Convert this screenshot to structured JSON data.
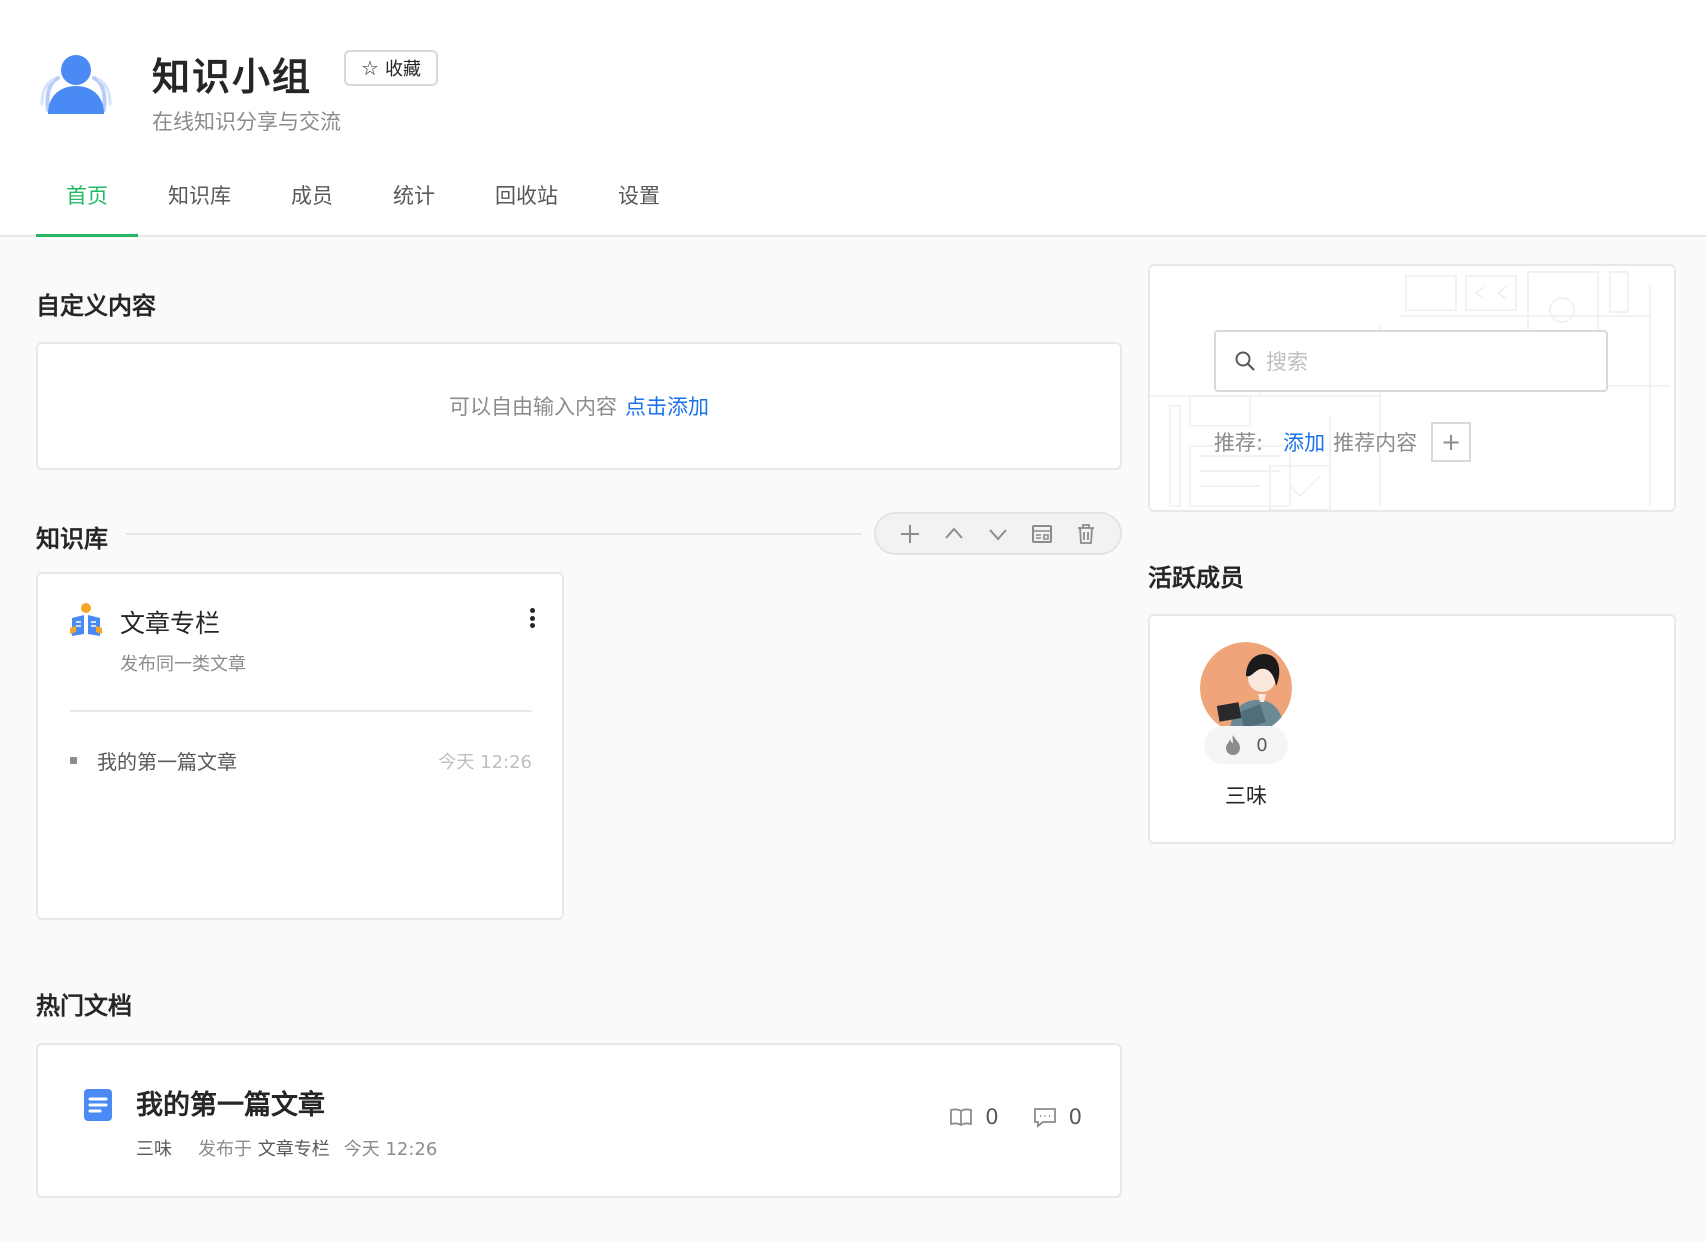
{
  "group": {
    "title": "知识小组",
    "subtitle": "在线知识分享与交流",
    "favorite_label": "收藏"
  },
  "tabs": [
    {
      "label": "首页",
      "active": true
    },
    {
      "label": "知识库",
      "active": false
    },
    {
      "label": "成员",
      "active": false
    },
    {
      "label": "统计",
      "active": false
    },
    {
      "label": "回收站",
      "active": false
    },
    {
      "label": "设置",
      "active": false
    }
  ],
  "custom_content": {
    "title": "自定义内容",
    "hint": "可以自由输入内容",
    "add_link": "点击添加"
  },
  "knowledge_base": {
    "title": "知识库",
    "toolbar_icons": [
      "plus-icon",
      "chevron-up-icon",
      "chevron-down-icon",
      "layout-icon",
      "trash-icon"
    ],
    "book": {
      "name": "文章专栏",
      "description": "发布同一类文章",
      "docs": [
        {
          "title": "我的第一篇文章",
          "time": "今天 12:26"
        }
      ]
    }
  },
  "hot_docs": {
    "title": "热门文档",
    "items": [
      {
        "title": "我的第一篇文章",
        "author": "三味",
        "published_in_label": "发布于",
        "book": "文章专栏",
        "time": "今天 12:26",
        "reads": "0",
        "comments": "0"
      }
    ]
  },
  "search": {
    "placeholder": "搜索",
    "recommend_label": "推荐:",
    "add_link": "添加",
    "recommend_text": "推荐内容",
    "plus": "+"
  },
  "active_members": {
    "title": "活跃成员",
    "members": [
      {
        "name": "三味",
        "score": "0"
      }
    ]
  },
  "colors": {
    "accent_green": "#25b864",
    "link_blue": "#1a73e8",
    "group_icon_blue": "#4a8af4"
  }
}
